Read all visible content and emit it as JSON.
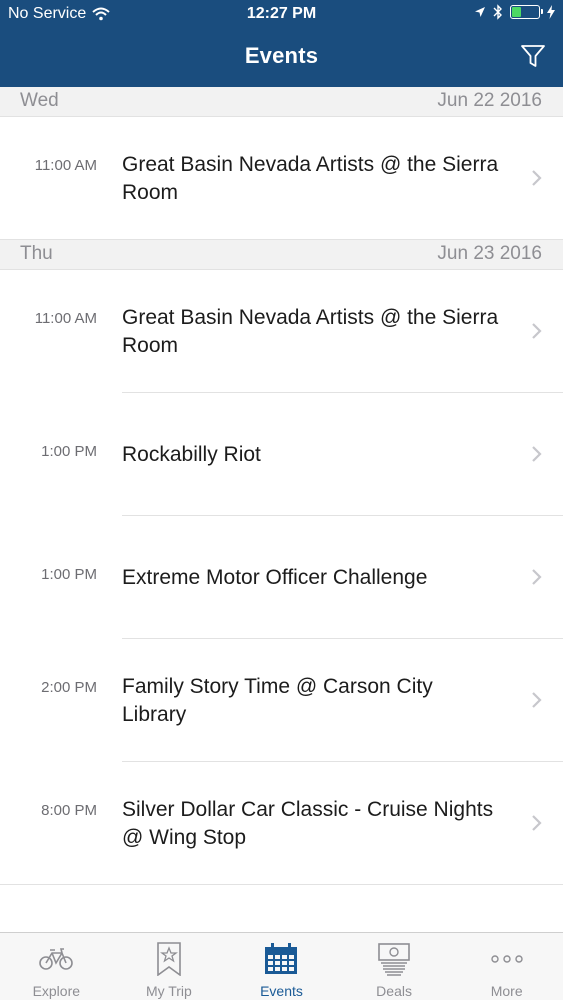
{
  "status_bar": {
    "carrier": "No Service",
    "time": "12:27 PM",
    "battery_level": 0.35,
    "battery_color": "#4cd964"
  },
  "navbar": {
    "title": "Events",
    "filter_icon": "filter-icon",
    "background": "#1a4d7e"
  },
  "sections": [
    {
      "day": "Wed",
      "date": "Jun 22 2016",
      "events": [
        {
          "time": "11:00 AM",
          "name": "Great Basin Nevada Artists @ the Sierra Room"
        }
      ]
    },
    {
      "day": "Thu",
      "date": "Jun 23 2016",
      "events": [
        {
          "time": "11:00 AM",
          "name": "Great Basin Nevada Artists @ the Sierra Room"
        },
        {
          "time": "1:00 PM",
          "name": "Rockabilly Riot"
        },
        {
          "time": "1:00 PM",
          "name": "Extreme Motor Officer Challenge"
        },
        {
          "time": "2:00 PM",
          "name": "Family Story Time @ Carson City Library"
        },
        {
          "time": "8:00 PM",
          "name": "Silver Dollar Car Classic - Cruise Nights @ Wing Stop"
        }
      ]
    }
  ],
  "tabs": [
    {
      "label": "Explore",
      "icon": "bicycle-icon",
      "active": false
    },
    {
      "label": "My Trip",
      "icon": "bookmark-star-icon",
      "active": false
    },
    {
      "label": "Events",
      "icon": "calendar-icon",
      "active": true
    },
    {
      "label": "Deals",
      "icon": "money-stack-icon",
      "active": false
    },
    {
      "label": "More",
      "icon": "more-dots-icon",
      "active": false
    }
  ]
}
